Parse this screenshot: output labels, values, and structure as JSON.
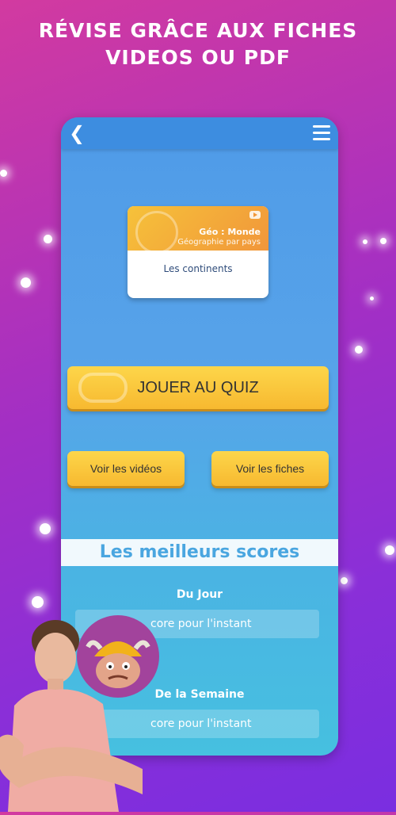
{
  "headline": {
    "line1": "RÉVISE GRÂCE AUX FICHES",
    "line2": "VIDEOS OU PDF"
  },
  "appbar": {
    "back_icon": "chevron-left-icon",
    "menu_icon": "hamburger-menu-icon"
  },
  "card": {
    "banner_title": "Géo : Monde",
    "banner_subtitle": "Géographie par pays",
    "title": "Les continents",
    "banner_icon": "play-video-icon"
  },
  "buttons": {
    "quiz": "JOUER AU QUIZ",
    "videos": "Voir les vidéos",
    "fiches": "Voir les fiches"
  },
  "scores": {
    "heading": "Les meilleurs scores",
    "day": {
      "label": "Du Jour",
      "empty": "Aucun score pour l'instant",
      "visible": "core pour l'instant"
    },
    "week": {
      "label": "De la Semaine",
      "empty": "Aucun score pour l'instant",
      "visible": "core pour l'instant"
    }
  },
  "colors": {
    "accent": "#3d8de0",
    "button": "#fdd64a",
    "heading": "#4aa6e0"
  }
}
